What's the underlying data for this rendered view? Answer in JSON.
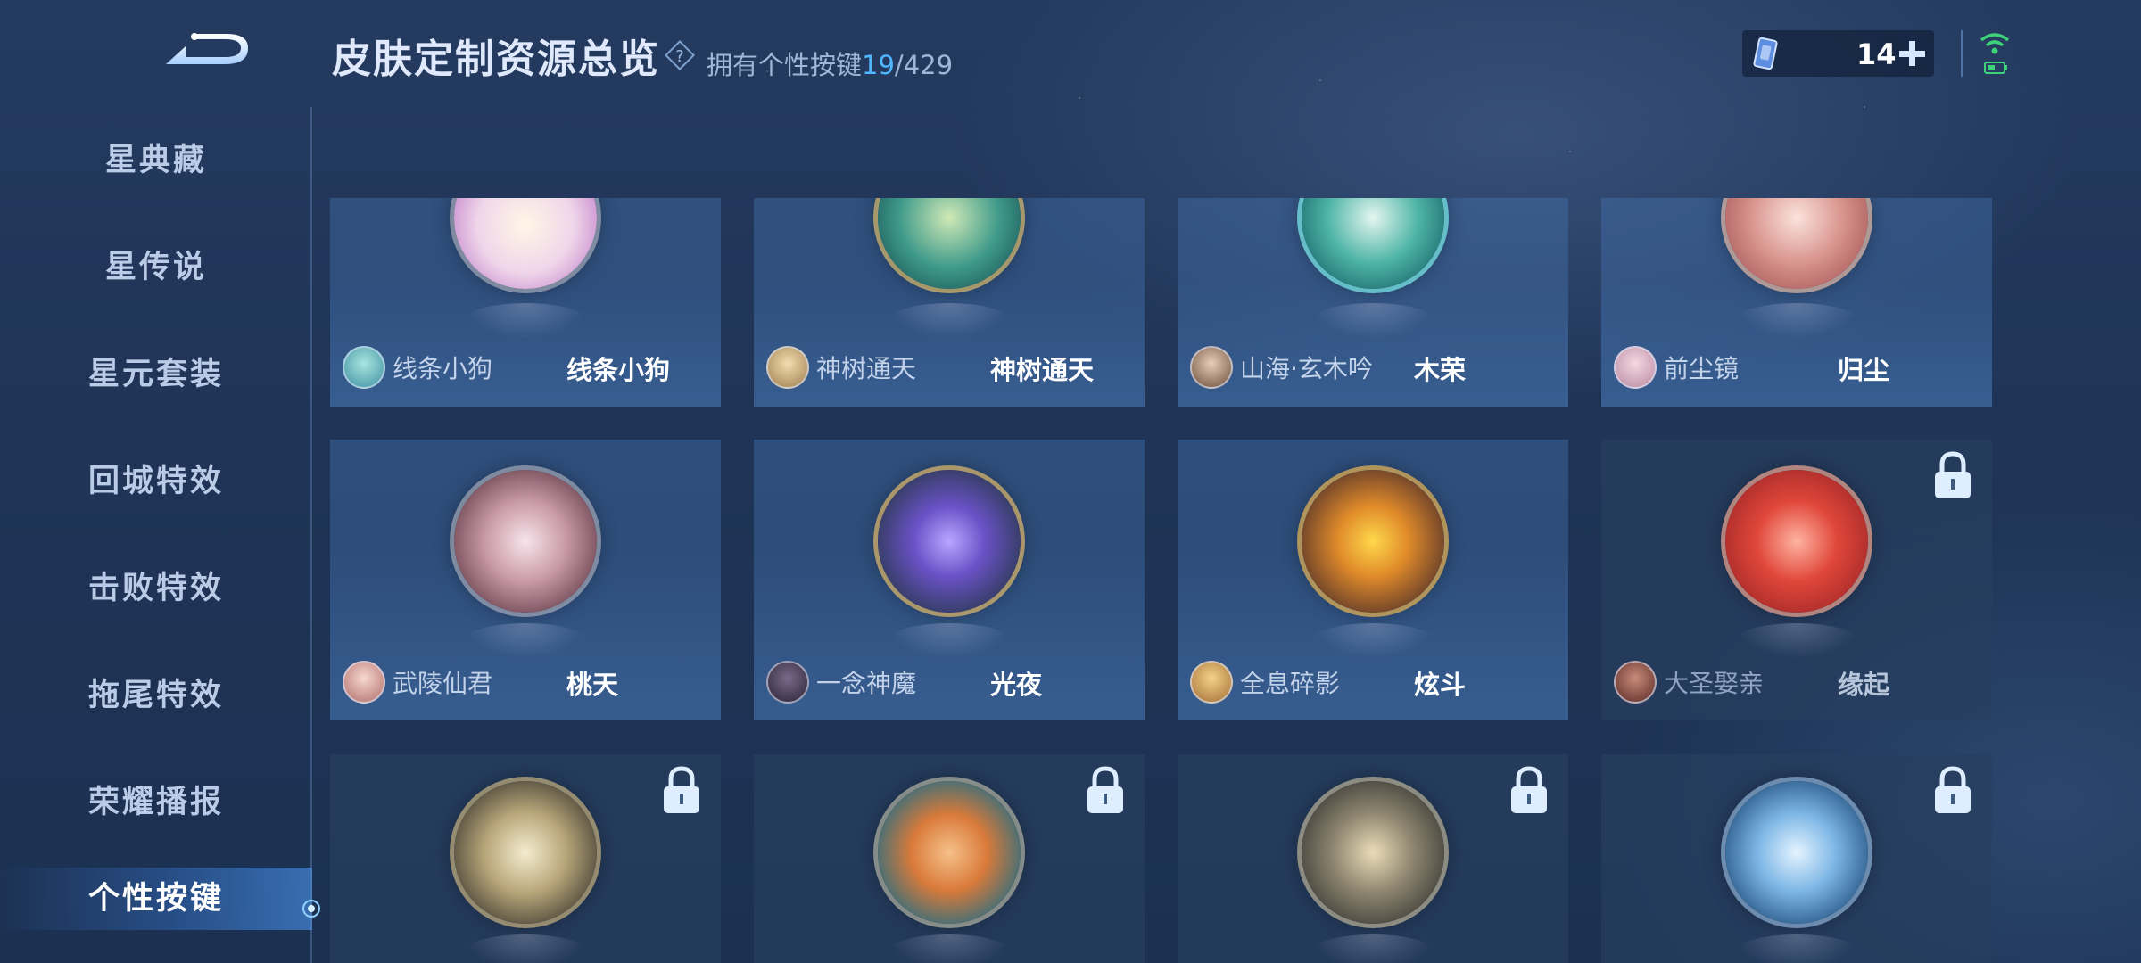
{
  "header": {
    "title": "皮肤定制资源总览",
    "owned_label": "拥有个性按键",
    "owned_count": "19",
    "owned_total": "/429"
  },
  "currency": {
    "value": "14"
  },
  "sidebar": {
    "items": [
      {
        "label": "星典藏",
        "active": false
      },
      {
        "label": "星传说",
        "active": false
      },
      {
        "label": "星元套装",
        "active": false
      },
      {
        "label": "回城特效",
        "active": false
      },
      {
        "label": "击败特效",
        "active": false
      },
      {
        "label": "拖尾特效",
        "active": false
      },
      {
        "label": "荣耀播报",
        "active": false
      },
      {
        "label": "个性按键",
        "active": true
      }
    ]
  },
  "grid": {
    "cards": [
      {
        "hero": "线条小狗",
        "skin": "线条小狗",
        "locked": false,
        "icon": "doodle-dog-medal"
      },
      {
        "hero": "神树通天",
        "skin": "神树通天",
        "locked": false,
        "icon": "sacred-tree-medal"
      },
      {
        "hero": "山海·玄木吟",
        "skin": "木荣",
        "locked": false,
        "icon": "jade-dragon-medal"
      },
      {
        "hero": "前尘镜",
        "skin": "归尘",
        "locked": false,
        "icon": "mirror-medal"
      },
      {
        "hero": "武陵仙君",
        "skin": "桃天",
        "locked": false,
        "icon": "lotus-flower-medal"
      },
      {
        "hero": "一念神魔",
        "skin": "光夜",
        "locked": false,
        "icon": "purple-blade-medal"
      },
      {
        "hero": "全息碎影",
        "skin": "炫斗",
        "locked": false,
        "icon": "gold-blade-medal"
      },
      {
        "hero": "大圣娶亲",
        "skin": "缘起",
        "locked": true,
        "icon": "red-staff-medal"
      },
      {
        "hero": "",
        "skin": "",
        "locked": true,
        "icon": "white-lotus-medal"
      },
      {
        "hero": "",
        "skin": "",
        "locked": true,
        "icon": "orange-orb-medal"
      },
      {
        "hero": "",
        "skin": "",
        "locked": true,
        "icon": "bone-scroll-medal"
      },
      {
        "hero": "",
        "skin": "",
        "locked": true,
        "icon": "blue-phoenix-medal"
      }
    ]
  }
}
